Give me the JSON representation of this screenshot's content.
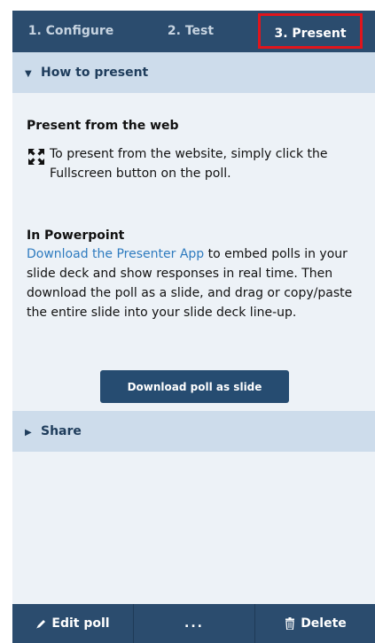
{
  "tabs": [
    {
      "label": "1. Configure"
    },
    {
      "label": "2. Test"
    },
    {
      "label": "3. Present"
    }
  ],
  "how_to_present": {
    "header": "How to present",
    "web_heading": "Present from the web",
    "web_text": "To present from the website, simply click the Fullscreen button on the poll.",
    "ppt_heading": "In Powerpoint",
    "ppt_link": "Download the Presenter App",
    "ppt_text": " to embed polls in your slide deck and show responses in real time. Then download the poll as a slide, and drag or copy/paste the entire slide into your slide deck line-up.",
    "download_button": "Download poll as slide"
  },
  "share": {
    "header": "Share"
  },
  "footer": {
    "edit_label": "Edit poll",
    "more_label": "...",
    "delete_label": "Delete"
  },
  "icons": {
    "fullscreen": "fullscreen-icon",
    "collapse": "caret-down-icon",
    "expand": "caret-right-icon",
    "edit": "pencil-icon",
    "delete": "trash-icon"
  },
  "colors": {
    "nav_bg": "#2b4c6e",
    "panel_bg": "#edf2f7",
    "section_header_bg": "#cddceb",
    "link": "#2e7bbf",
    "button_bg": "#264c71",
    "active_tab_outline": "#e0151c"
  }
}
